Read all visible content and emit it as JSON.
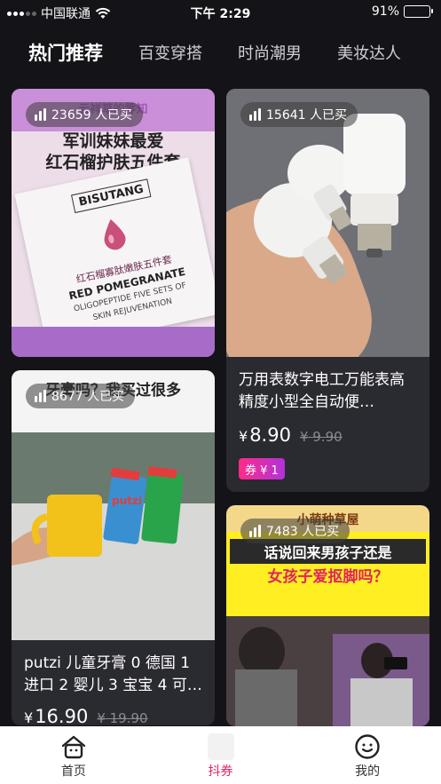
{
  "status_bar": {
    "carrier": "中国联通",
    "time": "下午 2:29",
    "battery": "91%",
    "battery_level": 0.91
  },
  "tabs": [
    {
      "label": "热门推荐",
      "active": true
    },
    {
      "label": "百变穿搭",
      "active": false
    },
    {
      "label": "时尚潮男",
      "active": false
    },
    {
      "label": "美妆达人",
      "active": false
    }
  ],
  "products": [
    {
      "sold": "23659 人已买",
      "image_text": {
        "top": "云祥草的零知",
        "headline_1": "军训妹妹最爱",
        "headline_2": "红石榴护肤五件套",
        "brand": "BISUTANG",
        "cn_name": "红石榴寡肽嫩肤五件套",
        "en_1": "RED POMEGRANATE",
        "en_2": "OLIGOPEPTIDE FIVE SETS OF",
        "en_3": "SKIN REJUVENATION"
      }
    },
    {
      "sold": "15641 人已买",
      "title": "万用表数字电工万能表高精度小型全自动便…",
      "price": "8.90",
      "currency": "¥",
      "old_price": "¥ 9.90",
      "coupon": "券 ¥ 1"
    },
    {
      "sold": "8677 人已买",
      "image_text": {
        "caption": "牙膏吗？我买过很多",
        "brand": "putzi"
      },
      "title": "putzi 儿童牙膏 0 德国 1 进口 2 婴儿 3 宝宝 4 可…",
      "price": "16.90",
      "currency": "¥",
      "old_price": "¥ 19.90"
    },
    {
      "sold": "7483 人已买",
      "image_text": {
        "top": "小萌种草屋",
        "headline_1": "话说回来男孩子还是",
        "headline_2": "女孩子爱抠脚吗？"
      }
    }
  ],
  "bottom_nav": [
    {
      "label": "首页",
      "icon": "home-icon",
      "active": false
    },
    {
      "label": "抖券",
      "icon": "coupon-icon",
      "active": true
    },
    {
      "label": "我的",
      "icon": "smiley-face-icon",
      "active": false
    }
  ],
  "colors": {
    "background": "#141418",
    "card": "#2a2a31",
    "accent": "#e0245e",
    "coupon_gradient": [
      "#ff2a8a",
      "#b033d8"
    ]
  }
}
